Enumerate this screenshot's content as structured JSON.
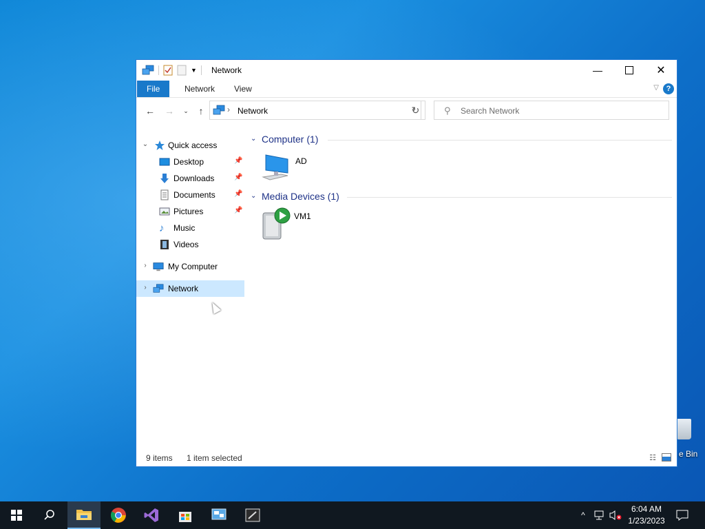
{
  "window": {
    "title": "Network",
    "ribbon_tabs": [
      "File",
      "Network",
      "View"
    ],
    "help_label": "?"
  },
  "address": {
    "path": "Network",
    "search_placeholder": "Search Network"
  },
  "nav_pane": {
    "quick_access": "Quick access",
    "items": [
      "Desktop",
      "Downloads",
      "Documents",
      "Pictures",
      "Music",
      "Videos"
    ],
    "my_computer": "My Computer",
    "network": "Network"
  },
  "content": {
    "groups": [
      {
        "title": "Computer (1)",
        "items": [
          "AD"
        ]
      },
      {
        "title": "Media Devices (1)",
        "items": [
          "VM1"
        ]
      }
    ]
  },
  "status": {
    "item_count": "9 items",
    "selection": "1 item selected"
  },
  "desktop": {
    "recycle_bin_label": "e Bin"
  },
  "taskbar": {
    "time": "6:04 AM",
    "date": "1/23/2023"
  },
  "colors": {
    "accent": "#1979ca",
    "selection": "#cce8ff",
    "group_header": "#1e3287",
    "taskbar": "#101820"
  }
}
